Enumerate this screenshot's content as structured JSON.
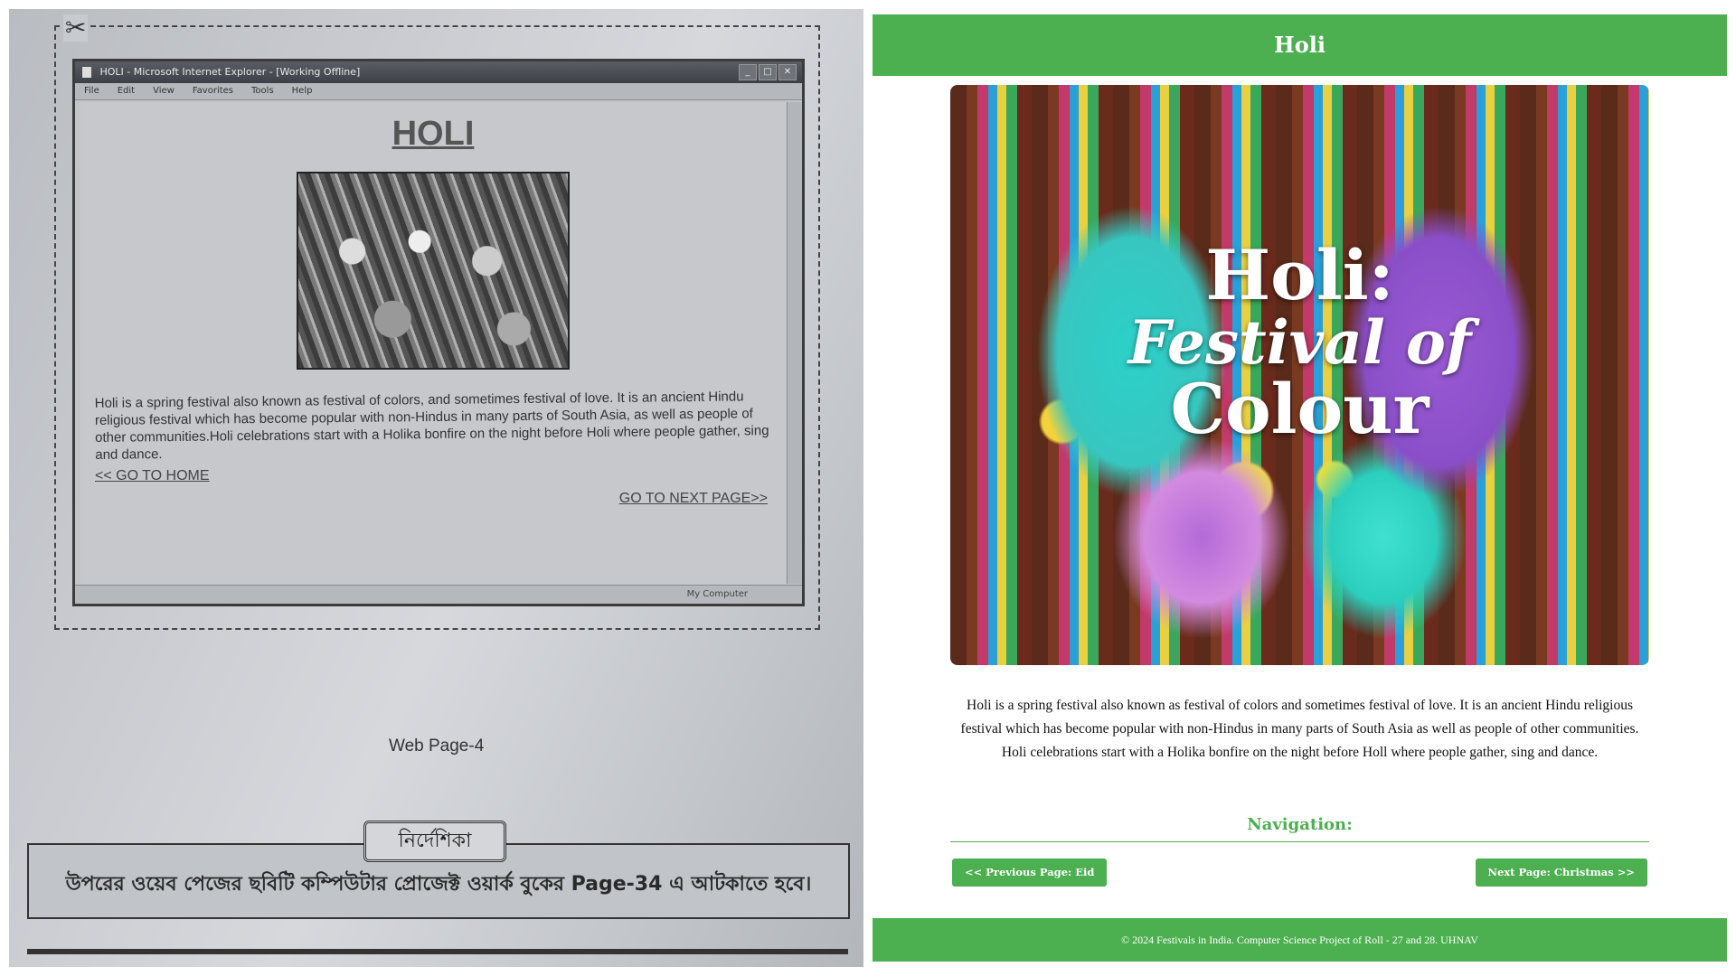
{
  "left_photo": {
    "ie_window": {
      "title": "HOLI - Microsoft Internet Explorer - [Working Offline]",
      "menu": [
        "File",
        "Edit",
        "View",
        "Favorites",
        "Tools",
        "Help"
      ],
      "status_text": "My Computer",
      "heading": "HOLI",
      "paragraph": "Holi is a spring festival also known as festival of colors, and sometimes festival of love. It is an ancient Hindu religious festival which has become popular with non-Hindus in many parts of South Asia, as well as people of other communities.Holi celebrations start with a Holika bonfire on the night before Holi where people gather, sing and dance.",
      "home_link": "<< GO TO HOME",
      "next_link": "GO TO NEXT PAGE>>"
    },
    "page_caption": "Web Page-4",
    "instruction_label": "নির্দেশিকা",
    "instruction_text": "উপরের ওয়েব পেজের ছবিটি কম্পিউটার প্রোজেক্ট ওয়ার্ক বুকের Page-34 এ আটকাতে হবে।"
  },
  "right_page": {
    "header_title": "Holi",
    "hero": {
      "line1": "Holi:",
      "line2": "Festival of",
      "line3": "Colour"
    },
    "description": "Holi is a spring festival also known as festival of colors and sometimes festival of love. It is an ancient Hindu religious festival which has become popular with non-Hindus in many parts of South Asia as well as people of other communities. Holi celebrations start with a Holika bonfire on the night before Holl where people gather, sing and dance.",
    "nav_heading": "Navigation:",
    "prev_button": "<< Previous Page: Eid",
    "next_button": "Next Page: Christmas >>",
    "footer": "© 2024 Festivals in India. Computer Science Project of Roll - 27 and 28. UHNAV",
    "colors": {
      "accent": "#4caf50",
      "text": "#111111",
      "background": "#ffffff"
    }
  }
}
